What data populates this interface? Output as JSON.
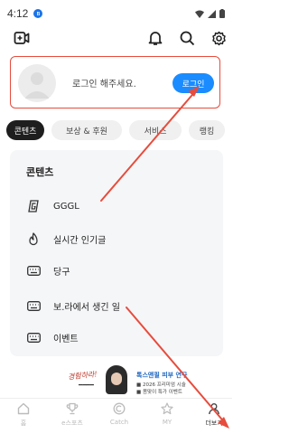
{
  "status_bar": {
    "time": "4:12",
    "bt_icon": "bluetooth-icon"
  },
  "header": {
    "icons": [
      "add-video-icon",
      "bell-icon",
      "search-icon",
      "gear-icon"
    ]
  },
  "login_card": {
    "prompt": "로그인 해주세요.",
    "button_label": "로그인"
  },
  "tabs": [
    {
      "label": "콘텐츠",
      "active": true
    },
    {
      "label": "보상 & 후원",
      "active": false
    },
    {
      "label": "서비스",
      "active": false
    },
    {
      "label": "랭킹",
      "active": false
    }
  ],
  "menu": {
    "title": "콘텐츠",
    "items": [
      {
        "label": "GGGL",
        "icon": "gggl-logo-icon"
      },
      {
        "label": "실시간 인기글",
        "icon": "fire-icon"
      },
      {
        "label": "당구",
        "icon": "keyboard-icon"
      },
      {
        "label": "보.라에서 생긴 일",
        "icon": "keyboard-icon"
      },
      {
        "label": "이벤트",
        "icon": "keyboard-icon"
      }
    ]
  },
  "ad": {
    "left_text": "경험하라!",
    "left_sub": "━━━━",
    "right_title": "톡스앤필 피부 연구",
    "right_line1": "■ 2026 프리미엄 시술",
    "right_line2": "■ 봄맞이 특가 이벤트"
  },
  "bottom_nav": [
    {
      "label": "홈",
      "icon": "home-icon",
      "active": false
    },
    {
      "label": "e스포츠",
      "icon": "trophy-icon",
      "active": false
    },
    {
      "label": "Catch",
      "icon": "catch-icon",
      "active": false
    },
    {
      "label": "MY",
      "icon": "star-icon",
      "active": false
    },
    {
      "label": "더보기",
      "icon": "person-icon",
      "active": true
    }
  ],
  "colors": {
    "highlight_red": "#e74c3c",
    "login_blue": "#1a8cff",
    "arrow_red": "#e74c3c"
  }
}
